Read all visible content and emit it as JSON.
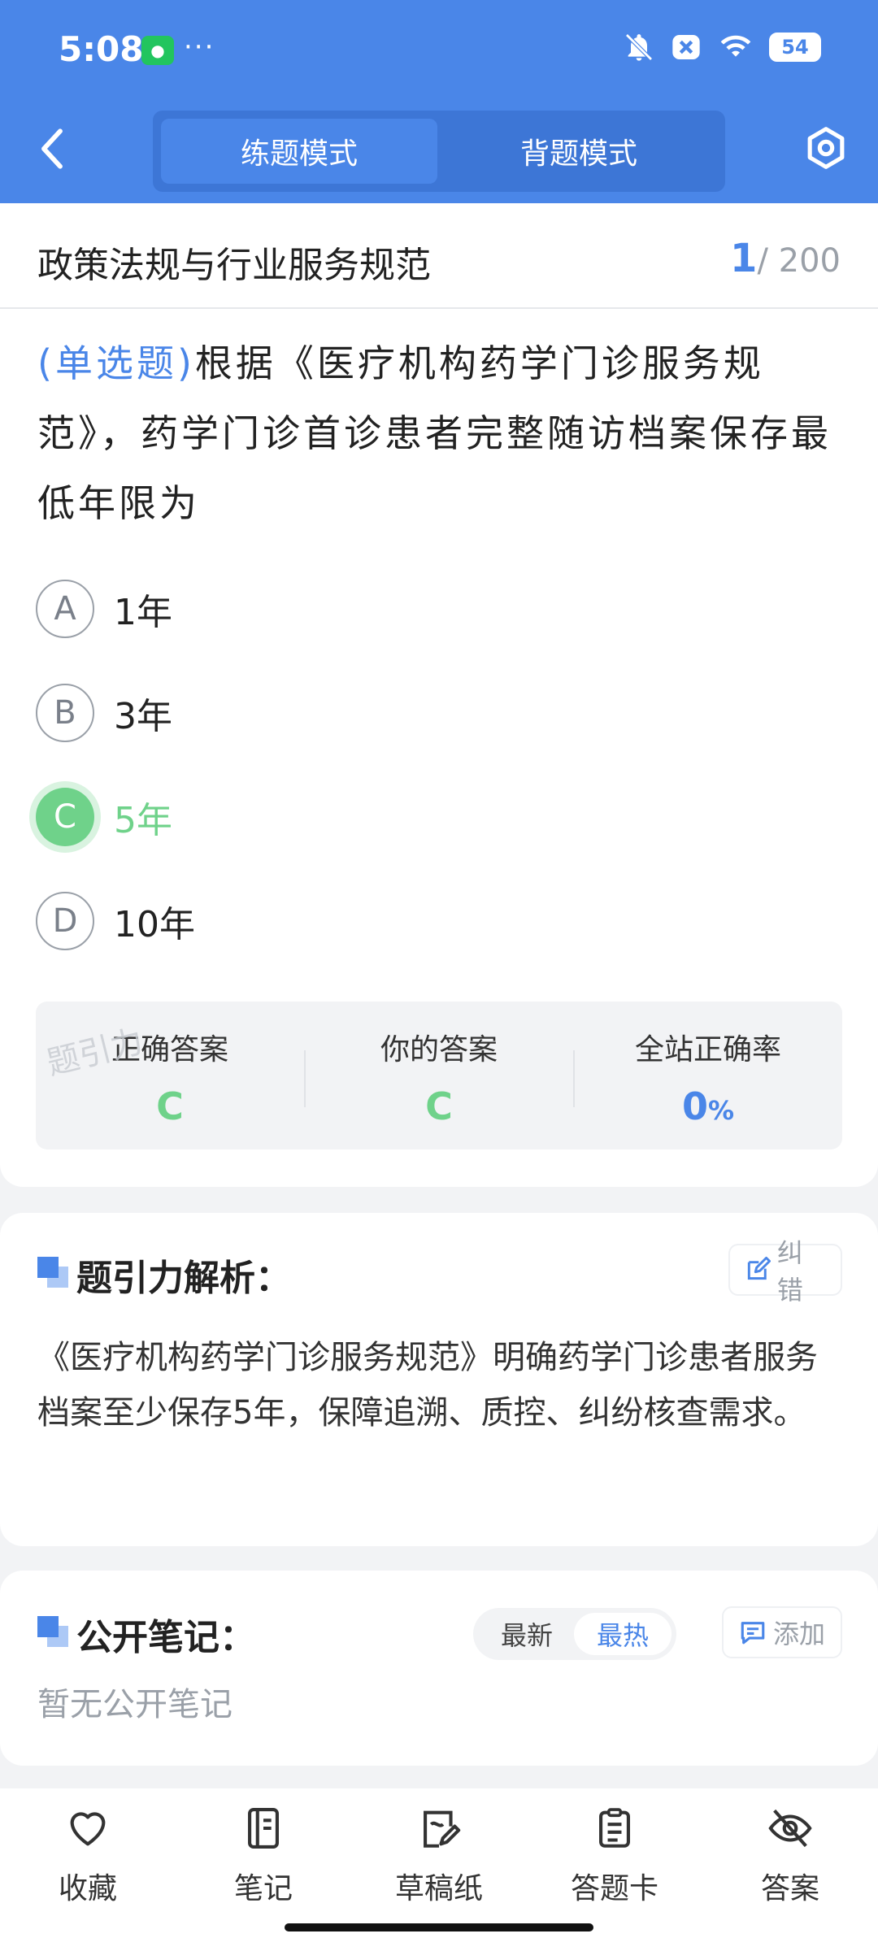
{
  "status": {
    "time": "5:08",
    "battery": "54"
  },
  "header": {
    "tab_practice": "练题模式",
    "tab_memorize": "背题模式"
  },
  "question": {
    "subject": "政策法规与行业服务规范",
    "current": "1",
    "total_text": "/ 200",
    "type_label": "(单选题)",
    "text": "根据《医疗机构药学门诊服务规范》，药学门诊首诊患者完整随访档案保存最低年限为",
    "options": [
      {
        "letter": "A",
        "text": "1年"
      },
      {
        "letter": "B",
        "text": "3年"
      },
      {
        "letter": "C",
        "text": "5年"
      },
      {
        "letter": "D",
        "text": "10年"
      }
    ],
    "answer_titles": {
      "correct": "正确答案",
      "yours": "你的答案",
      "rate": "全站正确率"
    },
    "answer_values": {
      "correct": "C",
      "yours": "C",
      "rate": "0",
      "rate_unit": "%"
    },
    "watermark": "题引力"
  },
  "analysis": {
    "title": "题引力解析：",
    "correct_btn": "纠错",
    "text": "《医疗机构药学门诊服务规范》明确药学门诊患者服务档案至少保存5年，保障追溯、质控、纠纷核查需求。"
  },
  "notes": {
    "title": "公开笔记：",
    "sort_newest": "最新",
    "sort_hottest": "最热",
    "add_btn": "添加",
    "empty": "暂无公开笔记"
  },
  "bottom_bar": [
    {
      "label": "收藏",
      "icon": "heart-icon"
    },
    {
      "label": "笔记",
      "icon": "notebook-icon"
    },
    {
      "label": "草稿纸",
      "icon": "draft-paper-icon"
    },
    {
      "label": "答题卡",
      "icon": "answer-sheet-icon"
    },
    {
      "label": "答案",
      "icon": "eye-off-icon"
    }
  ],
  "colors": {
    "primary": "#4a86e8",
    "correct": "#6fd28a"
  }
}
